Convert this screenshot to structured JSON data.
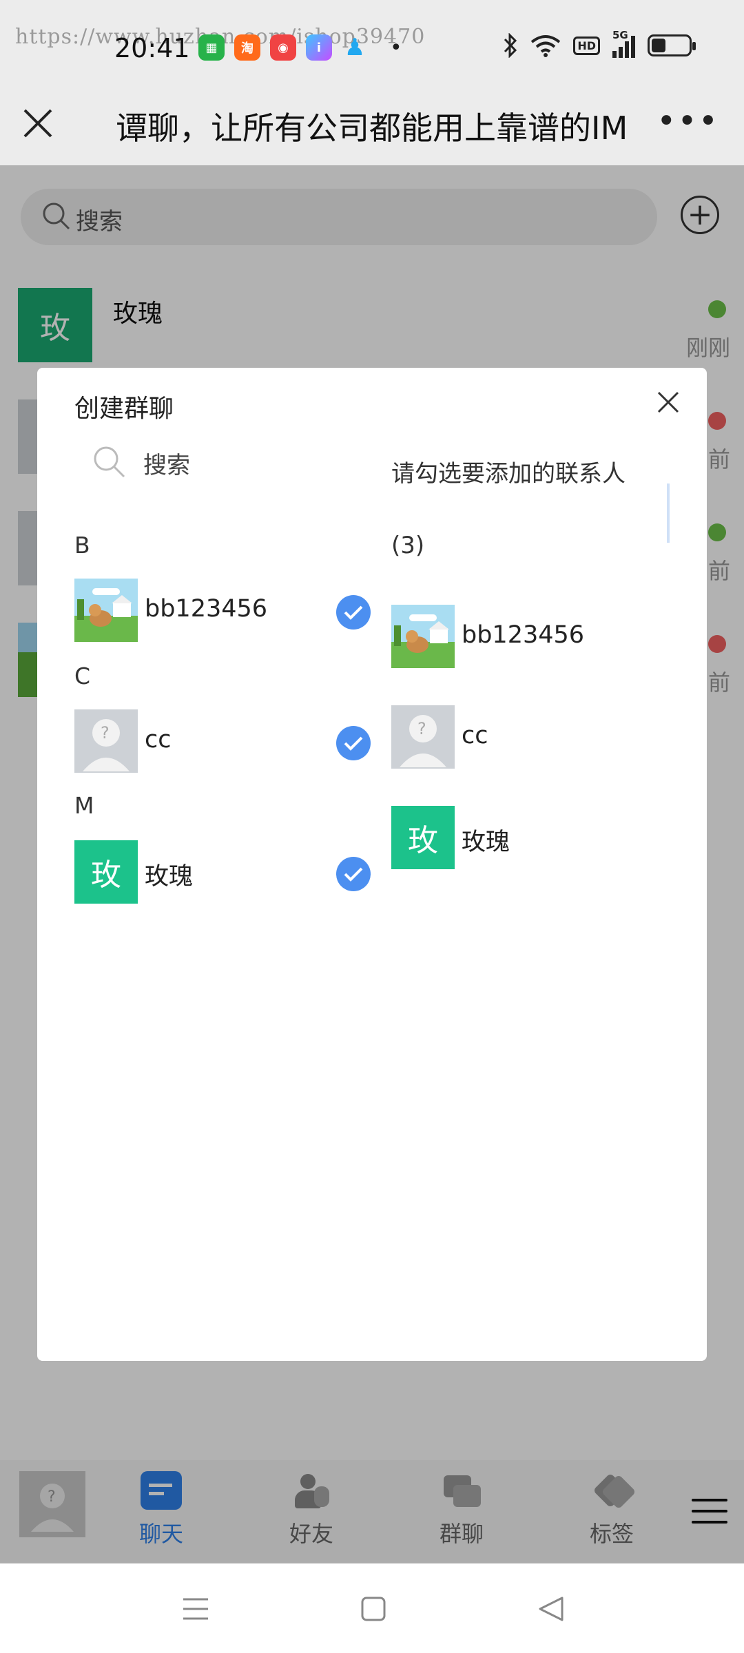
{
  "status_bar": {
    "watermark": "https://www.huzhan.com/ishop39470",
    "time": "20:41",
    "notification_icons": [
      "app-store-icon",
      "taobao-icon",
      "weibo-icon",
      "iqiyi-icon",
      "qq-icon"
    ],
    "more_indicator": "•",
    "hd_label": "HD",
    "network_label": "5G"
  },
  "title_bar": {
    "title": "谭聊，让所有公司都能用上靠谱的IM",
    "more": "•••"
  },
  "main": {
    "search_placeholder": "搜索",
    "chats": [
      {
        "avatar_text": "玫",
        "name": "玫瑰",
        "time": "刚刚",
        "status_color": "#6cc04a"
      },
      {
        "time": "前",
        "status_color": "#f06060"
      },
      {
        "time": "前",
        "status_color": "#6cc04a"
      },
      {
        "time": "前",
        "status_color": "#f06060"
      }
    ]
  },
  "modal": {
    "title": "创建群聊",
    "search_placeholder": "搜索",
    "contacts": [
      {
        "group": "B",
        "name": "bb123456",
        "avatar": "cartoon-avatar",
        "checked": true
      },
      {
        "group": "C",
        "name": "cc",
        "avatar": "ghost-avatar",
        "checked": true
      },
      {
        "group": "M",
        "name": "玫瑰",
        "avatar_text": "玫",
        "checked": true
      }
    ],
    "selected_title": "请勾选要添加的联系人",
    "selected_count": "(3)",
    "selected": [
      {
        "name": "bb123456",
        "avatar": "cartoon-avatar"
      },
      {
        "name": "cc",
        "avatar": "ghost-avatar"
      },
      {
        "name": "玫瑰",
        "avatar_text": "玫"
      }
    ]
  },
  "bottom_nav": {
    "items": [
      {
        "label": "聊天",
        "icon": "chat-icon",
        "active": true
      },
      {
        "label": "好友",
        "icon": "friends-icon",
        "active": false
      },
      {
        "label": "群聊",
        "icon": "group-chat-icon",
        "active": false
      },
      {
        "label": "标签",
        "icon": "tag-icon",
        "active": false
      }
    ]
  },
  "colors": {
    "accent": "#2f80e8",
    "check": "#4c8ff0",
    "letter_avatar": "#1cc28b",
    "online": "#6cc04a",
    "offline": "#f06060"
  }
}
